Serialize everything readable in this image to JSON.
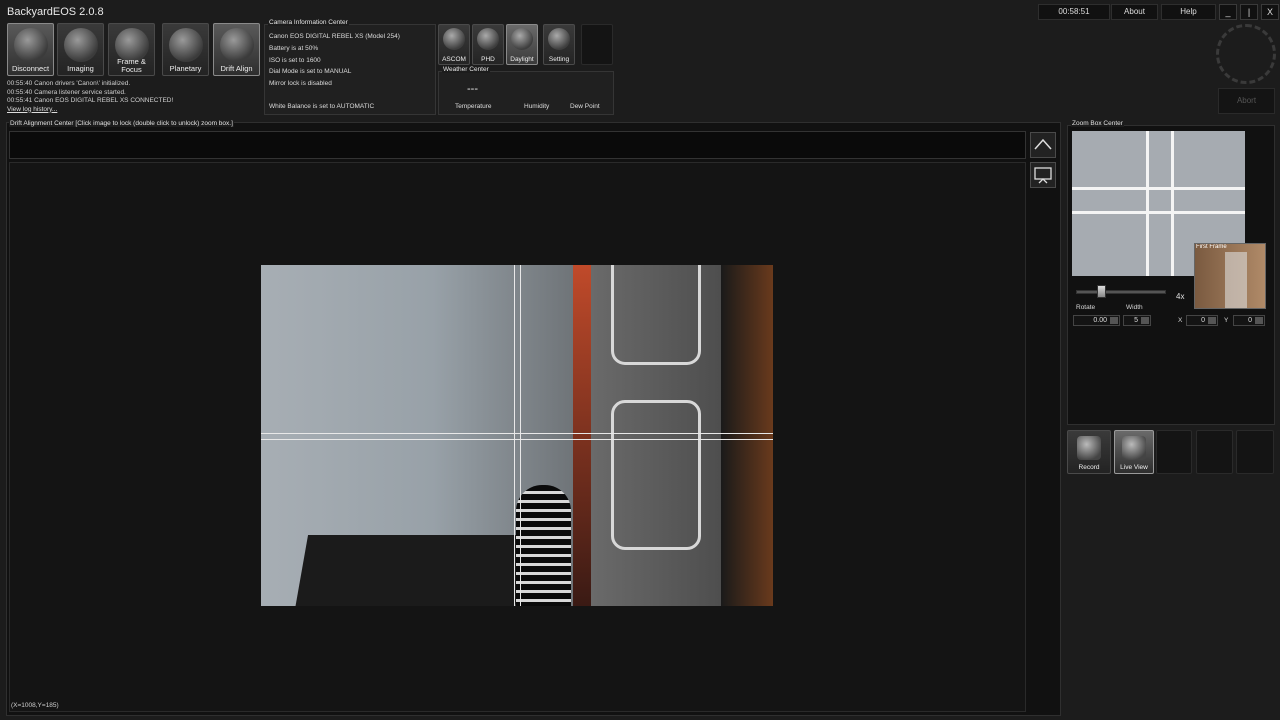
{
  "app": {
    "title": "BackyardEOS 2.0.8"
  },
  "topbar": {
    "clock": "00:58:51",
    "about": "About",
    "help": "Help",
    "minimize": "_",
    "restore": "|",
    "close": "X",
    "abort": "Abort"
  },
  "tools": [
    {
      "label": "Disconnect",
      "icon": "camera-icon"
    },
    {
      "label": "Imaging",
      "icon": "imaging-icon"
    },
    {
      "label": "Frame & Focus",
      "icon": "saturn-icon"
    },
    {
      "label": "Planetary",
      "icon": "planet-icon"
    },
    {
      "label": "Drift Align",
      "icon": "drift-align-icon"
    }
  ],
  "log": {
    "lines": [
      "00:55:40  Canon drivers 'Canon\\' initialized.",
      "00:55:40  Camera listener service started.",
      "00:55:41  Canon EOS DIGITAL REBEL XS CONNECTED!"
    ],
    "history_link": "View log history..."
  },
  "camera_info": {
    "title": "Camera Information Center",
    "lines": [
      "Canon EOS DIGITAL REBEL XS   (Model 254)",
      "Battery is at 50%",
      "ISO is set to 1600",
      "Dial Mode is set to MANUAL",
      "Mirror lock is disabled",
      "White Balance is set to AUTOMATIC"
    ]
  },
  "small_buttons": [
    {
      "label": "ASCOM",
      "icon": "ascom-icon"
    },
    {
      "label": "PHD",
      "icon": "phd-icon"
    },
    {
      "label": "Daylight",
      "icon": "sun-icon"
    },
    {
      "label": "Setting",
      "icon": "settings-icon"
    }
  ],
  "weather": {
    "title": "Weather Center",
    "value": "---",
    "labels": [
      "Temperature",
      "Humidity",
      "Dew Point"
    ]
  },
  "drift": {
    "title": "Drift Alignment Center   [Click image to lock (double click to unlock) zoom box.]",
    "coords": "(X=1008,Y=185)"
  },
  "zoom": {
    "title": "Zoom Box Center",
    "first_frame": "First Frame",
    "zoom_level": "4x",
    "rotate_label": "Rotate",
    "width_label": "Width",
    "rotate_value": "0.00",
    "width_value": "5",
    "x_label": "X",
    "x_value": "0",
    "y_label": "Y",
    "y_value": "0",
    "slider_fraction": 0.28
  },
  "capture": {
    "record": "Record",
    "live_view": "Live View"
  }
}
